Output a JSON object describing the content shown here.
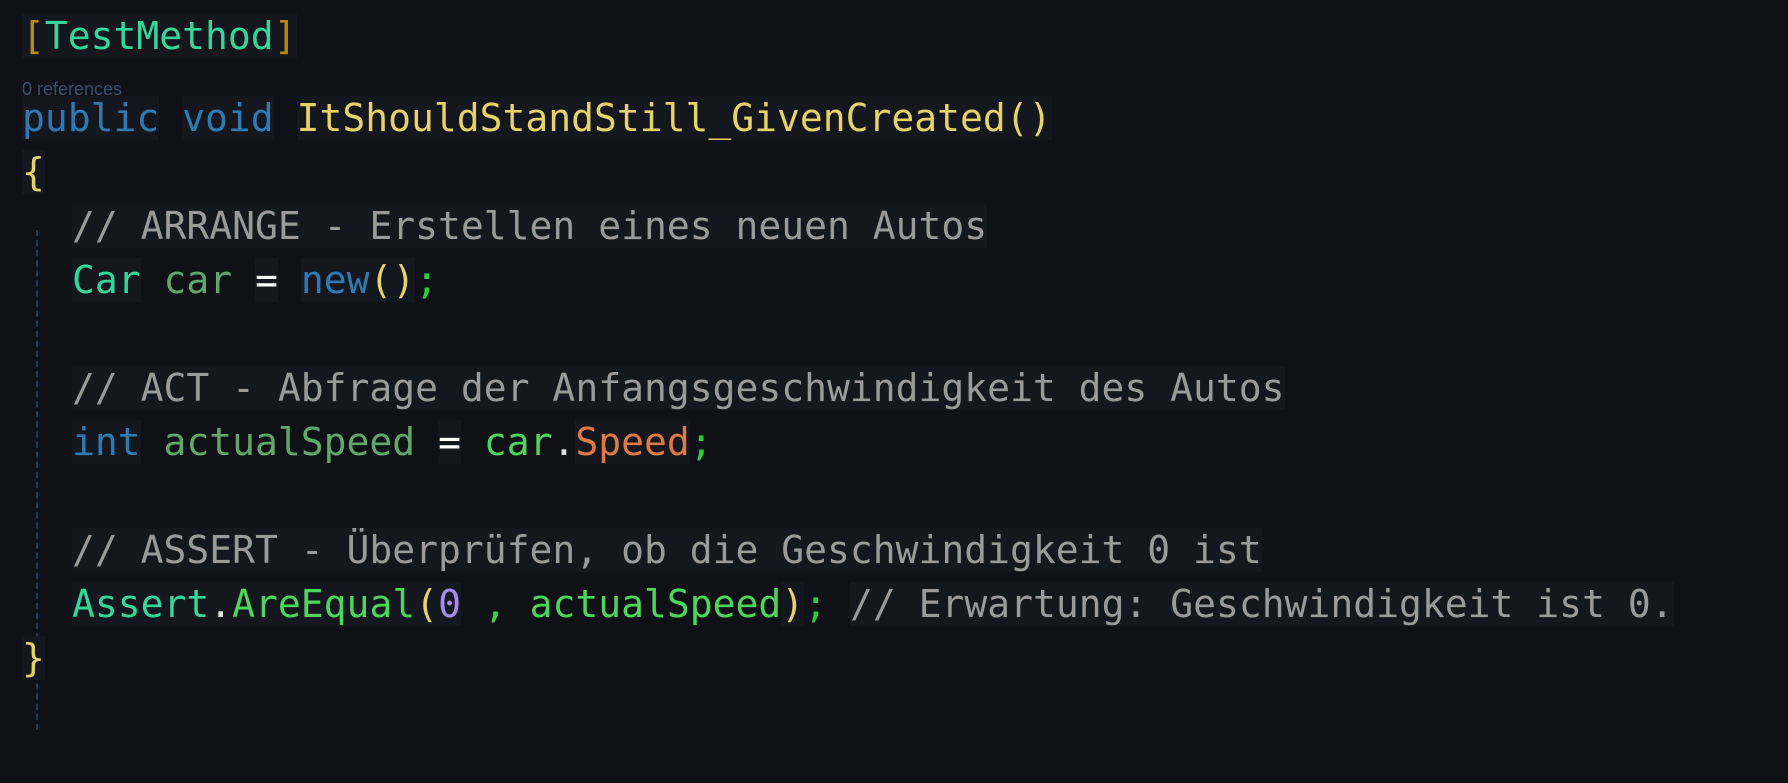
{
  "code": {
    "attribute": {
      "open": "[",
      "name": "TestMethod",
      "close": "]"
    },
    "codelens": "0 references",
    "signature": {
      "modifier": "public",
      "return_type": "void",
      "method_name": "ItShouldStandStill_GivenCreated",
      "parens": "()"
    },
    "open_brace": "{",
    "close_brace": "}",
    "arrange_comment": "// ARRANGE - Erstellen eines neuen Autos",
    "arrange_line": {
      "type": "Car",
      "var": "car",
      "op": "=",
      "new_kw": "new",
      "parens": "()",
      "semi": ";"
    },
    "act_comment": "// ACT - Abfrage der Anfangsgeschwindigkeit des Autos",
    "act_line": {
      "type": "int",
      "var": "actualSpeed",
      "op": "=",
      "obj": "car",
      "dot": ".",
      "prop": "Speed",
      "semi": ";"
    },
    "assert_comment": "// ASSERT - Überprüfen, ob die Geschwindigkeit 0 ist",
    "assert_line": {
      "class": "Assert",
      "dot": ".",
      "method": "AreEqual",
      "open_paren": "(",
      "num": "0",
      "comma": " , ",
      "arg": "actualSpeed",
      "close_paren": ")",
      "semi": ";",
      "trailing_comment": "// Erwartung: Geschwindigkeit ist 0."
    }
  }
}
